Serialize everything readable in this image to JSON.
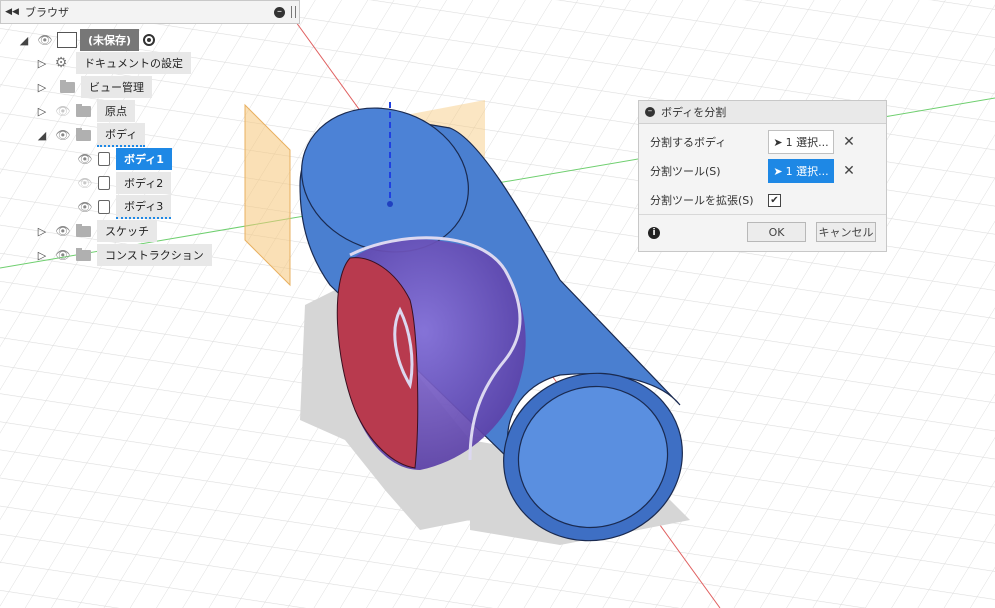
{
  "browser": {
    "title": "ブラウザ",
    "root": {
      "label": "(未保存)"
    },
    "items": [
      {
        "label": "ドキュメントの設定"
      },
      {
        "label": "ビュー管理"
      },
      {
        "label": "原点"
      },
      {
        "label": "ボディ"
      },
      {
        "label": "ボディ1"
      },
      {
        "label": "ボディ2"
      },
      {
        "label": "ボディ3"
      },
      {
        "label": "スケッチ"
      },
      {
        "label": "コンストラクション"
      }
    ]
  },
  "dialog": {
    "title": "ボディを分割",
    "rows": [
      {
        "label": "分割するボディ",
        "value": "1 選択..."
      },
      {
        "label": "分割ツール(S)",
        "value": "1 選択..."
      },
      {
        "label": "分割ツールを拡張(S)"
      }
    ],
    "ok_label": "OK",
    "cancel_label": "キャンセル"
  },
  "colors": {
    "accent": "#1e88e5",
    "body_blue": "#4a7fd0",
    "cut_face_red": "#b83a4e",
    "sphere_purple": "#6c55b8",
    "plane_orange": "#f5c882"
  },
  "icons": {
    "collapse": "double-chevron-left-icon",
    "eye": "eye-icon",
    "gear": "gear-icon",
    "folder": "folder-icon",
    "body": "body-icon",
    "info": "info-icon",
    "close": "close-icon",
    "cursor": "cursor-arrow-icon"
  }
}
